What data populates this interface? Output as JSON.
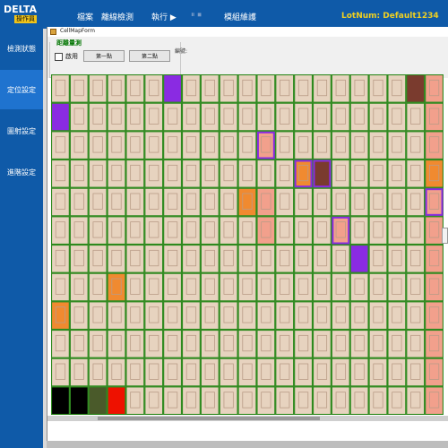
{
  "app": {
    "logo": {
      "brand": "DELTA",
      "subbrand": "操作員"
    },
    "menu": [
      {
        "label": "檔案",
        "disabled": false
      },
      {
        "label": "離線檢測",
        "disabled": false
      },
      {
        "label": "執行 ▶",
        "disabled": false
      },
      {
        "label": "⏸ ⏹",
        "disabled": true
      },
      {
        "label": "模組維護",
        "disabled": false
      }
    ],
    "lot_num": "LotNum: Default1234"
  },
  "sidebar": {
    "items": [
      {
        "label": "檢測狀態",
        "active": false
      },
      {
        "label": "定位設定",
        "active": true
      },
      {
        "label": "圖射設定",
        "active": false
      },
      {
        "label": "進階設定",
        "active": false
      }
    ]
  },
  "window": {
    "title": "CellMapForm",
    "group_title": "距離量測",
    "enable_label": "啟用",
    "enable_checked": false,
    "button_first": "第一點",
    "button_second": "第二點",
    "code_label": "編號:"
  },
  "cellmap": {
    "columns": 21,
    "rows": 12,
    "default_color": "#e7d3bf",
    "colors": {
      "purple": "#8a2be2",
      "orange": "#f08a30",
      "salmon": "#f2a08c",
      "brown": "#7a3b2e",
      "black": "#000000",
      "red": "#ee1100",
      "dark_olive": "#4a5a2a"
    },
    "highlights": [
      {
        "col": 6,
        "row": 0,
        "color": "purple"
      },
      {
        "col": 19,
        "row": 0,
        "color": "brown"
      },
      {
        "col": 0,
        "row": 1,
        "color": "purple"
      },
      {
        "col": 11,
        "row": 2,
        "color": "salmon",
        "outline": "purple"
      },
      {
        "col": 13,
        "row": 3,
        "color": "orange",
        "outline": "purple"
      },
      {
        "col": 14,
        "row": 3,
        "color": "brown",
        "outline": "purple"
      },
      {
        "col": 20,
        "row": 3,
        "color": "orange"
      },
      {
        "col": 10,
        "row": 4,
        "color": "orange"
      },
      {
        "col": 11,
        "row": 4,
        "color": "salmon"
      },
      {
        "col": 20,
        "row": 4,
        "color": "salmon",
        "outline": "purple"
      },
      {
        "col": 11,
        "row": 5,
        "color": "salmon"
      },
      {
        "col": 15,
        "row": 5,
        "color": "salmon",
        "outline": "purple"
      },
      {
        "col": 16,
        "row": 6,
        "color": "purple"
      },
      {
        "col": 3,
        "row": 7,
        "color": "orange"
      },
      {
        "col": 0,
        "row": 8,
        "color": "orange"
      },
      {
        "col": 0,
        "row": 11,
        "color": "black"
      },
      {
        "col": 1,
        "row": 11,
        "color": "black"
      },
      {
        "col": 2,
        "row": 11,
        "color": "dark_olive"
      },
      {
        "col": 3,
        "row": 11,
        "color": "red"
      }
    ],
    "salmon_columns": [
      20
    ]
  }
}
